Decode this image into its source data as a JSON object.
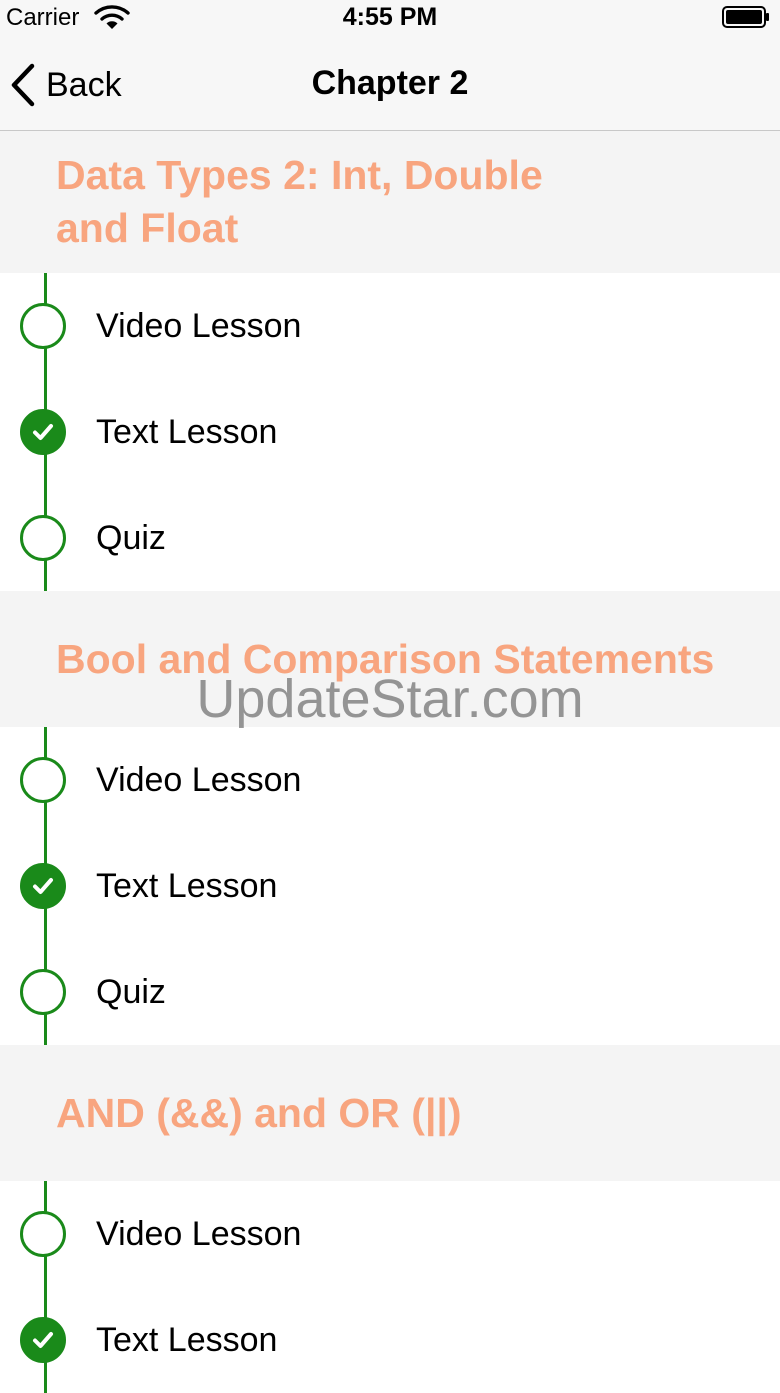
{
  "status_bar": {
    "carrier": "Carrier",
    "time": "4:55 PM"
  },
  "nav": {
    "back_label": "Back",
    "title": "Chapter 2"
  },
  "sections": [
    {
      "title": "Data Types 2: Int, Double and Float",
      "items": [
        {
          "label": "Video Lesson",
          "completed": false
        },
        {
          "label": "Text Lesson",
          "completed": true
        },
        {
          "label": "Quiz",
          "completed": false
        }
      ]
    },
    {
      "title": "Bool and Comparison Statements",
      "items": [
        {
          "label": "Video Lesson",
          "completed": false
        },
        {
          "label": "Text Lesson",
          "completed": true
        },
        {
          "label": "Quiz",
          "completed": false
        }
      ]
    },
    {
      "title": "AND (&&) and OR (||)",
      "items": [
        {
          "label": "Video Lesson",
          "completed": false
        },
        {
          "label": "Text Lesson",
          "completed": true
        }
      ]
    }
  ],
  "watermark": "UpdateStar.com",
  "colors": {
    "accent": "#1a8a1a",
    "section_title": "#f8a57f"
  }
}
